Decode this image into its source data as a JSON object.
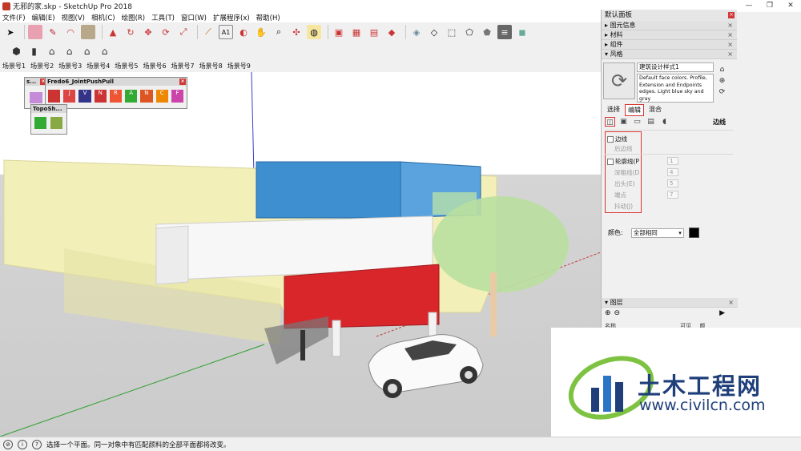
{
  "window": {
    "title": "无邪的家.skp - SketchUp Pro 2018",
    "minimize": "—",
    "maximize": "❐",
    "close": "✕"
  },
  "menu": [
    "文件(F)",
    "编辑(E)",
    "视图(V)",
    "相机(C)",
    "绘图(R)",
    "工具(T)",
    "窗口(W)",
    "扩展程序(x)",
    "帮助(H)"
  ],
  "scenes": [
    "场景号1",
    "场景号2",
    "场景号3",
    "场景号4",
    "场景号5",
    "场景号6",
    "场景号7",
    "场景号8",
    "场景号9"
  ],
  "floating_toolbars": {
    "s_title": "s...",
    "fredo_title": "Fredo6_JointPushPull",
    "fredo_letters": [
      "",
      "J",
      "V",
      "N",
      "R",
      "A",
      "N",
      "C",
      "F"
    ],
    "topo_title": "TopoSh..."
  },
  "tray": {
    "title": "默认面板",
    "sections": {
      "entity_info": "图元信息",
      "materials": "材料",
      "components": "组件",
      "styles": "风格"
    },
    "style": {
      "name": "建筑设计样式1",
      "description": "Default face colors. Profile, Extension and Endpoints edges. Light blue sky and gray"
    },
    "tabs": {
      "select": "选择",
      "edit": "编辑",
      "mix": "混合"
    },
    "edit_section_label": "边线",
    "edge_options": [
      {
        "label": "边线",
        "checked": false,
        "enabled": true,
        "value": ""
      },
      {
        "label": "后边线",
        "checked": false,
        "enabled": false,
        "value": ""
      },
      {
        "label": "轮廓线(P",
        "checked": false,
        "enabled": true,
        "value": "1"
      },
      {
        "label": "深粗线(D",
        "checked": false,
        "enabled": false,
        "value": "4"
      },
      {
        "label": "出头(E)",
        "checked": false,
        "enabled": false,
        "value": "5"
      },
      {
        "label": "端点",
        "checked": false,
        "enabled": false,
        "value": "7"
      },
      {
        "label": "抖动(J)",
        "checked": false,
        "enabled": false,
        "value": ""
      }
    ],
    "color_label": "颜色:",
    "color_value": "全部相同",
    "color_swatch": "#000000",
    "layers": {
      "title": "图层",
      "col_name": "名称",
      "col_visible": "可见",
      "col_color": "颜"
    }
  },
  "status": {
    "text": "选择一个平面。同一对象中有匹配颜料的全部平面都将改变。"
  },
  "watermark": {
    "title": "土木工程网",
    "url": "www.civilcn.com"
  },
  "colors": {
    "container_blue": "#3e8fd0",
    "container_red": "#d8262b",
    "wall_yellow": "#f3efb8",
    "tree_green": "#b9dfa0",
    "accent_red_border": "#d93333",
    "brand_blue": "#1f3f7a"
  }
}
